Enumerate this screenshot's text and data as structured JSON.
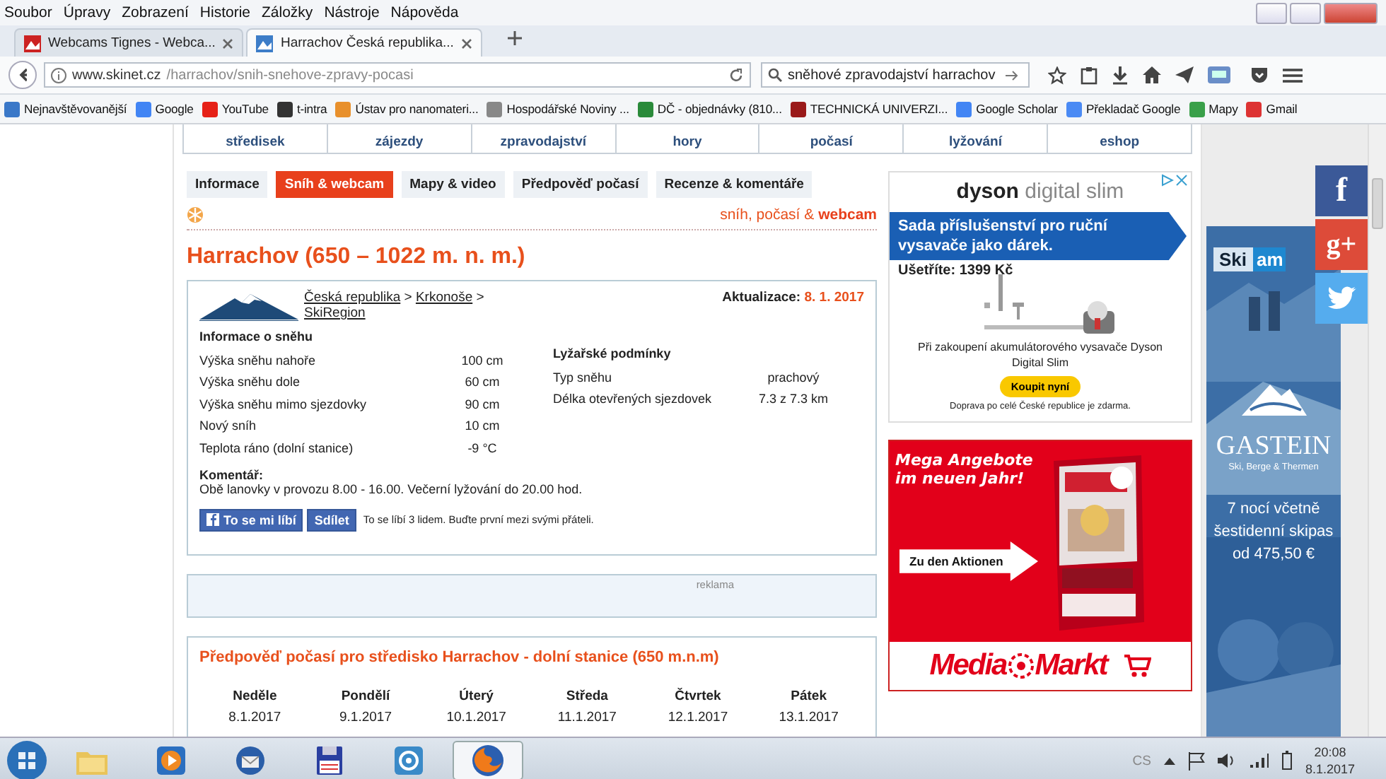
{
  "menu": [
    "Soubor",
    "Úpravy",
    "Zobrazení",
    "Historie",
    "Záložky",
    "Nástroje",
    "Nápověda"
  ],
  "browser_tabs": [
    {
      "title": "Webcams Tignes - Webca...",
      "selected": false
    },
    {
      "title": "Harrachov Česká republika...",
      "selected": true
    }
  ],
  "address_bar": {
    "host": "www.skinet.cz",
    "path": "/harrachov/snih-snehove-zpravy-pocasi"
  },
  "search_field": {
    "value": "sněhové zpravodajství harrachov"
  },
  "bookmarks": [
    "Nejnavštěvovanější",
    "Google",
    "YouTube",
    "t-intra",
    "Ústav pro nanomateri...",
    "Hospodářské Noviny ...",
    "DČ - objednávky (810...",
    "TECHNICKÁ UNIVERZI...",
    "Google Scholar",
    "Překladač Google",
    "Mapy",
    "Gmail"
  ],
  "site_nav": [
    "středisek",
    "zájezdy",
    "zpravodajství",
    "hory",
    "počasí",
    "lyžování",
    "eshop"
  ],
  "page_tabs": [
    {
      "label": "Informace",
      "selected": false
    },
    {
      "label": "Sníh & webcam",
      "selected": true
    },
    {
      "label": "Mapy & video",
      "selected": false
    },
    {
      "label": "Předpověď počasí",
      "selected": false
    },
    {
      "label": "Recenze & komentáře",
      "selected": false
    }
  ],
  "tagline": "sníh, počasí & **webcam**",
  "title": "Harrachov (650 – 1022 m. n. m.)",
  "breadcrumb": [
    {
      "kind": "link",
      "text": "Česká republika"
    },
    {
      "kind": "separator",
      "text": ">"
    },
    {
      "kind": "link",
      "text": "Krkonoše"
    },
    {
      "kind": "separator",
      "text": ">"
    },
    {
      "kind": "link",
      "text": "SkiRegion"
    }
  ],
  "update": {
    "label": "Aktualizace:",
    "date": "8. 1. 2017"
  },
  "snow_info": {
    "title": "Informace o sněhu",
    "rows": [
      {
        "label": "Výška sněhu nahoře",
        "value": "100 cm"
      },
      {
        "label": "Výška sněhu dole",
        "value": "60 cm"
      },
      {
        "label": "Výška sněhu mimo sjezdovky",
        "value": "90 cm"
      },
      {
        "label": "Nový sníh",
        "value": "10 cm"
      },
      {
        "label": "Teplota ráno (dolní stanice)",
        "value": "-9 °C"
      }
    ]
  },
  "ski_conditions": {
    "title": "Lyžařské podmínky",
    "rows": [
      {
        "label": "Typ sněhu",
        "value": "prachový"
      },
      {
        "label": "Délka otevřených sjezdovek",
        "value": "7.3 z 7.3 km"
      }
    ]
  },
  "comment": {
    "label": "Komentář:",
    "text": "Obě lanovky v provozu 8.00 - 16.00. Večerní lyžování do 20.00 hod."
  },
  "facebook": {
    "like": "To se mi líbí",
    "share": "Sdílet",
    "text": "To se líbí 3 lidem. Buďte první mezi svými přáteli."
  },
  "ad_label": "reklama",
  "forecast": {
    "title": "Předpověď počasí pro středisko Harrachov - dolní stanice (650 m.n.m)",
    "days": [
      {
        "day": "Neděle",
        "date": "8.1.2017"
      },
      {
        "day": "Pondělí",
        "date": "9.1.2017"
      },
      {
        "day": "Úterý",
        "date": "10.1.2017"
      },
      {
        "day": "Středa",
        "date": "11.1.2017"
      },
      {
        "day": "Čtvrtek",
        "date": "12.1.2017"
      },
      {
        "day": "Pátek",
        "date": "13.1.2017"
      }
    ]
  },
  "dyson_ad": {
    "brand": "dyson",
    "product": "digital slim",
    "banner": "Sada příslušenství pro ruční vysavače jako dárek.",
    "saving": "Ušetříte: 1399 Kč",
    "text": "Při zakoupení akumulátorového vysavače Dyson Digital Slim",
    "button": "Koupit nyní",
    "footer": "Doprava po celé České republice je zdarma."
  },
  "mediamarkt_ad": {
    "headline": "Mega Angebote im neuen Jahr!",
    "cta": "Zu den Aktionen",
    "logo": [
      "Media",
      "Markt"
    ]
  },
  "gastein_ad": {
    "tag": "Ski",
    "tag_cut": "am",
    "brand": "GASTEIN",
    "slogan": "Ski, Berge & Thermen",
    "offer": "7 nocí včetně šestidenní skipas od 475,50 €"
  },
  "social": [
    {
      "kind": "facebook",
      "glyph": "f",
      "color": "#3b5998"
    },
    {
      "kind": "googleplus",
      "glyph": "g+",
      "color": "#dd4b39"
    },
    {
      "kind": "twitter",
      "color": "#55acee"
    }
  ],
  "taskbar": {
    "apps": [
      {
        "kind": "folder",
        "selected": false
      },
      {
        "kind": "player",
        "selected": false
      },
      {
        "kind": "mail",
        "selected": false
      },
      {
        "kind": "disk",
        "selected": false
      },
      {
        "kind": "target",
        "selected": false
      },
      {
        "kind": "browser",
        "selected": true
      }
    ],
    "language": "CS",
    "time": "20:08",
    "date": "8.1.2017"
  }
}
